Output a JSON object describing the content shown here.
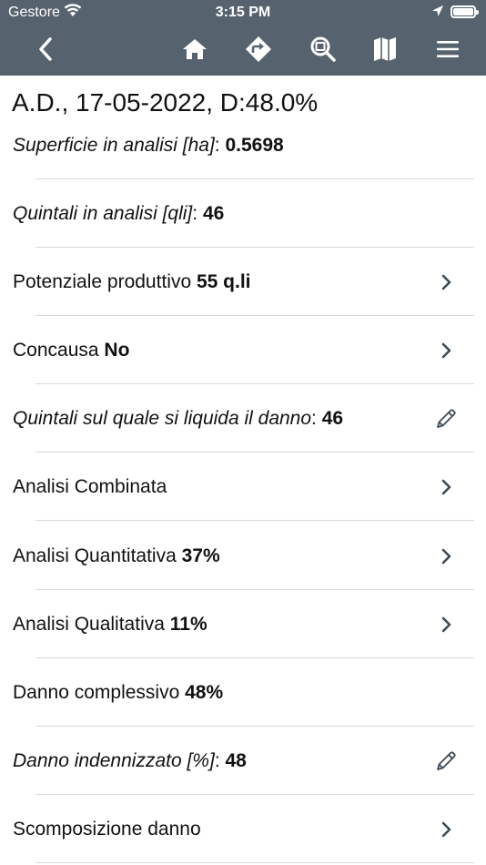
{
  "status_bar": {
    "carrier": "Gestore",
    "time": "3:15 PM"
  },
  "nav": {
    "back_icon": "chevron-left-icon",
    "icons": [
      "home-icon",
      "directions-icon",
      "zoom-icon",
      "map-icon",
      "menu-icon"
    ]
  },
  "header": {
    "title": "A.D., 17-05-2022,  D:48.0%"
  },
  "rows": [
    {
      "label": "Superficie in analisi [ha]",
      "sep": ": ",
      "value": "0.5698",
      "italic": true
    },
    {
      "label": "Quintali in analisi [qli]",
      "sep": ": ",
      "value": "46",
      "italic": true
    },
    {
      "label": "Potenziale produttivo",
      "sep": " ",
      "value": "55 q.li",
      "accessory": "chevron"
    },
    {
      "label": "Concausa",
      "sep": " ",
      "value": "No",
      "accessory": "chevron"
    },
    {
      "label": "Quintali sul quale si liquida il danno",
      "sep": ": ",
      "value": "46",
      "italic": true,
      "accessory": "pencil"
    },
    {
      "label": "Analisi Combinata",
      "sep": "",
      "value": "",
      "accessory": "chevron"
    },
    {
      "label": "Analisi Quantitativa",
      "sep": " ",
      "value": "37%",
      "accessory": "chevron"
    },
    {
      "label": "Analisi Qualitativa",
      "sep": " ",
      "value": "11%",
      "accessory": "chevron"
    },
    {
      "label": "Danno complessivo",
      "sep": " ",
      "value": "48%"
    },
    {
      "label": "Danno indennizzato [%]",
      "sep": ": ",
      "value": "48",
      "italic": true,
      "accessory": "pencil"
    },
    {
      "label": "Scomposizione danno",
      "sep": "",
      "value": "",
      "accessory": "chevron"
    }
  ],
  "colors": {
    "topbar": "#56636f",
    "separator": "#d9d9d9",
    "chevron": "#3d4a57"
  }
}
